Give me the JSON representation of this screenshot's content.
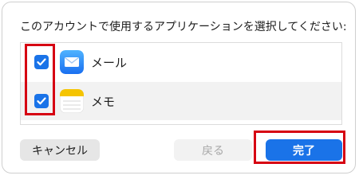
{
  "dialog": {
    "prompt": "このアカウントで使用するアプリケーションを選択してください:",
    "apps": [
      {
        "name": "メール",
        "checked": true,
        "icon": "mail-app-icon"
      },
      {
        "name": "メモ",
        "checked": true,
        "icon": "notes-app-icon"
      }
    ],
    "buttons": {
      "cancel": "キャンセル",
      "back": "戻る",
      "done": "完了"
    }
  },
  "colors": {
    "accent": "#1a73e8",
    "highlight": "#d60012",
    "disabled_text": "#a8a8a8"
  }
}
